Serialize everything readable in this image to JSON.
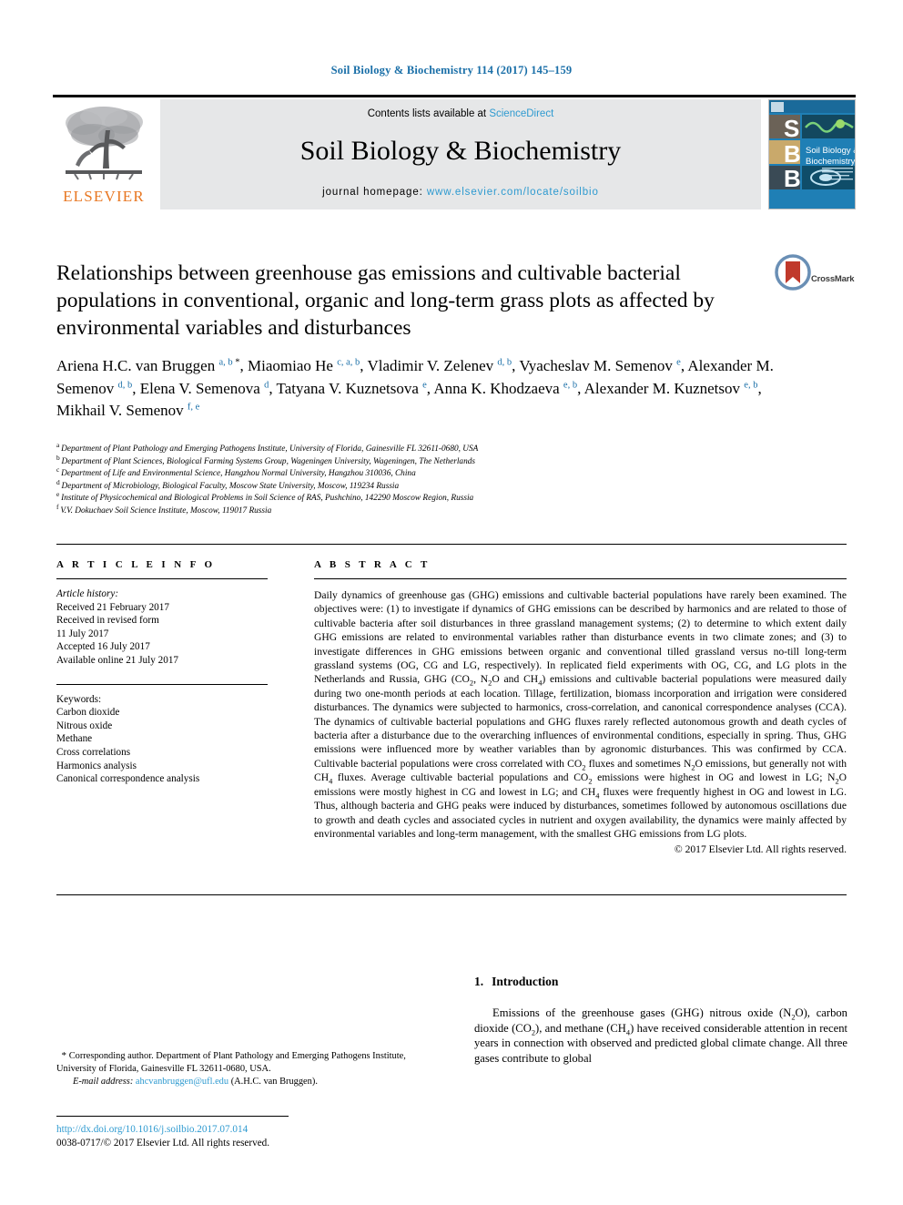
{
  "running_head": "Soil Biology & Biochemistry 114 (2017) 145–159",
  "masthead": {
    "contents_prefix": "Contents lists available at ",
    "contents_link": "ScienceDirect",
    "journal_title": "Soil Biology & Biochemistry",
    "homepage_prefix": "journal homepage: ",
    "homepage_url": "www.elsevier.com/locate/soilbio",
    "publisher_logo_text": "ELSEVIER",
    "cover": {
      "letters": [
        "S",
        "B",
        "B"
      ],
      "title_line1": "Soil Biology &",
      "title_line2": "Biochemistry"
    }
  },
  "crossmark": {
    "label": "CrossMark"
  },
  "title": "Relationships between greenhouse gas emissions and cultivable bacterial populations in conventional, organic and long-term grass plots as affected by environmental variables and disturbances",
  "authors": [
    {
      "name": "Ariena H.C. van Bruggen",
      "marks": "a, b",
      "star": true,
      "sep": ", "
    },
    {
      "name": "Miaomiao He",
      "marks": "c, a, b",
      "star": false,
      "sep": ", "
    },
    {
      "name": "Vladimir V. Zelenev",
      "marks": "d, b",
      "star": false,
      "sep": ", "
    },
    {
      "name": "Vyacheslav M. Semenov",
      "marks": "e",
      "star": false,
      "sep": ", "
    },
    {
      "name": "Alexander M. Semenov",
      "marks": "d, b",
      "star": false,
      "sep": ", "
    },
    {
      "name": "Elena V. Semenova",
      "marks": "d",
      "star": false,
      "sep": ", "
    },
    {
      "name": "Tatyana V. Kuznetsova",
      "marks": "e",
      "star": false,
      "sep": ", "
    },
    {
      "name": "Anna K. Khodzaeva",
      "marks": "e, b",
      "star": false,
      "sep": ", "
    },
    {
      "name": "Alexander M. Kuznetsov",
      "marks": "e, b",
      "star": false,
      "sep": ", "
    },
    {
      "name": "Mikhail V. Semenov",
      "marks": "f, e",
      "star": false,
      "sep": ""
    }
  ],
  "affiliations": [
    {
      "mark": "a",
      "text": "Department of Plant Pathology and Emerging Pathogens Institute, University of Florida, Gainesville FL 32611-0680, USA"
    },
    {
      "mark": "b",
      "text": "Department of Plant Sciences, Biological Farming Systems Group, Wageningen University, Wageningen, The Netherlands"
    },
    {
      "mark": "c",
      "text": "Department of Life and Environmental Science, Hangzhou Normal University, Hangzhou 310036, China"
    },
    {
      "mark": "d",
      "text": "Department of Microbiology, Biological Faculty, Moscow State University, Moscow, 119234 Russia"
    },
    {
      "mark": "e",
      "text": "Institute of Physicochemical and Biological Problems in Soil Science of RAS, Pushchino, 142290 Moscow Region, Russia"
    },
    {
      "mark": "f",
      "text": "V.V. Dokuchaev Soil Science Institute, Moscow, 119017 Russia"
    }
  ],
  "article_info": {
    "heading": "A R T I C L E   I N F O",
    "history_label": "Article history:",
    "history": [
      "Received 21 February 2017",
      "Received in revised form",
      "11 July 2017",
      "Accepted 16 July 2017",
      "Available online 21 July 2017"
    ],
    "keywords_label": "Keywords:",
    "keywords": [
      "Carbon dioxide",
      "Nitrous oxide",
      "Methane",
      "Cross correlations",
      "Harmonics analysis",
      "Canonical correspondence analysis"
    ]
  },
  "abstract": {
    "heading": "A B S T R A C T",
    "paragraphs": [
      "Daily dynamics of greenhouse gas (GHG) emissions and cultivable bacterial populations have rarely been examined. The objectives were: (1) to investigate if dynamics of GHG emissions can be described by harmonics and are related to those of cultivable bacteria after soil disturbances in three grassland management systems; (2) to determine to which extent daily GHG emissions are related to environmental variables rather than disturbance events in two climate zones; and (3) to investigate differences in GHG emissions between organic and conventional tilled grassland versus no-till long-term grassland systems (OG, CG and LG, respectively). In replicated field experiments with OG, CG, and LG plots in the Netherlands and Russia, GHG (CO2, N2O and CH4) emissions and cultivable bacterial populations were measured daily during two one-month periods at each location. Tillage, fertilization, biomass incorporation and irrigation were considered disturbances. The dynamics were subjected to harmonics, cross-correlation, and canonical correspondence analyses (CCA). The dynamics of cultivable bacterial populations and GHG fluxes rarely reflected autonomous growth and death cycles of bacteria after a disturbance due to the overarching influences of environmental conditions, especially in spring. Thus, GHG emissions were influenced more by weather variables than by agronomic disturbances. This was confirmed by CCA. Cultivable bacterial populations were cross correlated with CO2 fluxes and sometimes N2O emissions, but generally not with CH4 fluxes. Average cultivable bacterial populations and CO2 emissions were highest in OG and lowest in LG; N2O emissions were mostly highest in CG and lowest in LG; and CH4 fluxes were frequently highest in OG and lowest in LG. Thus, although bacteria and GHG peaks were induced by disturbances, sometimes followed by autonomous oscillations due to growth and death cycles and associated cycles in nutrient and oxygen availability, the dynamics were mainly affected by environmental variables and long-term management, with the smallest GHG emissions from LG plots."
    ],
    "copyright": "© 2017 Elsevier Ltd. All rights reserved."
  },
  "introduction": {
    "number": "1.",
    "heading": "Introduction",
    "text": "Emissions of the greenhouse gases (GHG) nitrous oxide (N2O), carbon dioxide (CO2), and methane (CH4) have received considerable attention in recent years in connection with observed and predicted global climate change. All three gases contribute to global"
  },
  "footnotes": {
    "corresponding": "Corresponding author. Department of Plant Pathology and Emerging Pathogens Institute, University of Florida, Gainesville FL 32611-0680, USA.",
    "email_label": "E-mail address:",
    "email": "ahcvanbruggen@ufl.edu",
    "email_suffix": "(A.H.C. van Bruggen).",
    "doi": "http://dx.doi.org/10.1016/j.soilbio.2017.07.014",
    "issn_line": "0038-0717/© 2017 Elsevier Ltd. All rights reserved."
  },
  "colors": {
    "link_blue": "#2e9ad0",
    "header_blue": "#1a6fa8",
    "elsevier_orange": "#e87722",
    "masthead_grey": "#e6e7e8",
    "cover_blue": "#1f7fb5"
  }
}
